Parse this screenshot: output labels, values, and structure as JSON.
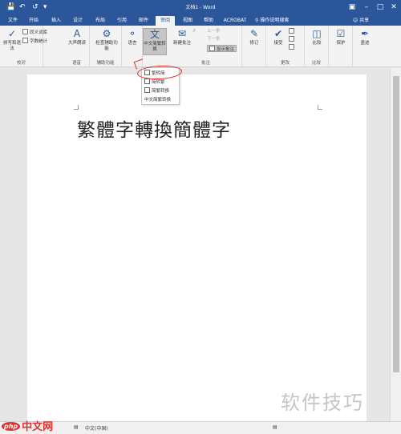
{
  "window": {
    "title": "文档1 - Word",
    "quick_access": [
      "save-icon",
      "undo-icon",
      "redo-icon",
      "customize-icon"
    ]
  },
  "tabs": [
    {
      "label": "文件"
    },
    {
      "label": "开始"
    },
    {
      "label": "插入"
    },
    {
      "label": "设计"
    },
    {
      "label": "布局"
    },
    {
      "label": "引用"
    },
    {
      "label": "邮件"
    },
    {
      "label": "审阅",
      "active": true
    },
    {
      "label": "视图"
    },
    {
      "label": "帮助"
    },
    {
      "label": "ACROBAT"
    }
  ],
  "tell_me": "操作说明搜索",
  "share": "共享",
  "ribbon": {
    "proofing": {
      "label": "校对",
      "spelling": "拼写和语法",
      "thesaurus": "同义词库",
      "word_count": "字数统计"
    },
    "speech": {
      "label": "语音",
      "read_aloud": "大声朗读"
    },
    "accessibility": {
      "label": "辅助功能",
      "check": "检查辅助功能"
    },
    "language": {
      "label": "语言",
      "translate": "语言"
    },
    "chinese_conversion": {
      "label": "中文简繁转换"
    },
    "comments": {
      "label": "批注",
      "new_comment": "新建批注",
      "delete": "删除",
      "previous": "上一条",
      "next": "下一条",
      "show_comments": "显示批注"
    },
    "tracking": {
      "label": "修订",
      "track": "修订"
    },
    "changes": {
      "label": "更改",
      "accept": "接受"
    },
    "compare": {
      "label": "比较",
      "compare": "比较"
    },
    "protect": {
      "label": "保护",
      "protect": "保护"
    },
    "ink": {
      "label": "墨迹",
      "ink": "墨迹"
    }
  },
  "dropdown": {
    "items": [
      {
        "label": "繁转简"
      },
      {
        "label": "简转繁"
      },
      {
        "label": "简繁转换"
      },
      {
        "label": "中文简繁转换"
      }
    ]
  },
  "document": {
    "text": "繁體字轉換簡體字"
  },
  "status": {
    "language": "中文(中国)"
  },
  "watermark": {
    "right": "软件技巧",
    "left_logo": "php",
    "left_text": "中文网"
  }
}
